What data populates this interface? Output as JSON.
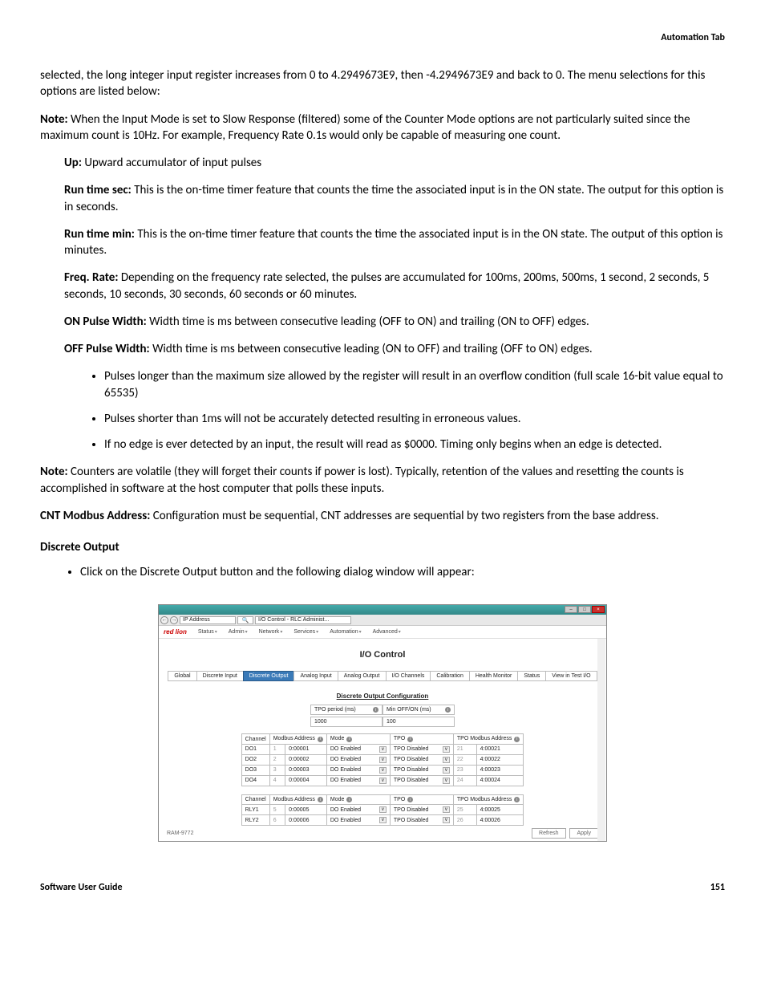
{
  "header": {
    "right": "Automation Tab"
  },
  "intro": "selected, the long integer input register increases from 0 to 4.2949673E9, then -4.2949673E9 and back to 0. The menu selections for this options are listed below:",
  "note1_label": "Note:",
  "note1": " When the Input Mode is set to Slow Response (filtered) some of the Counter Mode options are not particularly suited since the maximum count is 10Hz. For example, Frequency Rate 0.1s would only be capable of measuring one count.",
  "defs": {
    "up_l": "Up:",
    "up": " Upward accumulator of input pulses",
    "rts_l": "Run time sec:",
    "rts": " This is the on-time timer feature that counts the time the associated input is in the ON state. The output for this option is in seconds.",
    "rtm_l": "Run time min:",
    "rtm": " This is the on-time timer feature that counts the time the associated input is in the ON state. The output of this option is minutes.",
    "fr_l": "Freq. Rate:",
    "fr": " Depending on the frequency rate selected, the pulses are accumulated for 100ms, 200ms, 500ms, 1 second, 2 seconds, 5 seconds, 10 seconds, 30 seconds, 60 seconds or 60 minutes.",
    "on_l": "ON Pulse Width:",
    "on": " Width time is ms between consecutive leading (OFF to ON) and trailing (ON to OFF) edges.",
    "off_l": "OFF Pulse Width:",
    "off": " Width time is ms between consecutive leading (ON to OFF) and trailing (OFF to ON) edges."
  },
  "bullets": [
    "Pulses longer than the maximum size allowed by the register will result in an overflow condition (full scale 16-bit value equal to 65535)",
    "Pulses shorter than 1ms will not be accurately detected resulting in erroneous values.",
    "If no edge is ever detected by an input, the result will read as $0000. Timing only begins when an edge is detected."
  ],
  "note2_label": "Note:",
  "note2": " Counters are volatile (they will forget their counts if power is lost). Typically, retention of the values and resetting the counts is accomplished in software at the host computer that polls these inputs.",
  "cnt_l": "CNT Modbus Address:",
  "cnt": " Configuration must be sequential, CNT addresses are sequential by two registers from the base address.",
  "section": "Discrete Output",
  "section_bullet": "Click on the Discrete Output button and the following dialog window will appear:",
  "footer": {
    "left": "Software User Guide",
    "right": "151"
  },
  "shot": {
    "addr": "IP Address",
    "search_glyph": "🔍",
    "tab_title": "I/O Control - RLC Administ...",
    "menus": [
      "Status",
      "Admin",
      "Network",
      "Services",
      "Automation",
      "Advanced"
    ],
    "logo": "red lion",
    "title": "I/O Control",
    "tabs": [
      "Global",
      "Discrete Input",
      "Discrete Output",
      "Analog Input",
      "Analog Output",
      "I/O Channels",
      "Calibration",
      "Health Monitor",
      "Status",
      "View in Test I/O"
    ],
    "active_tab_index": 2,
    "subtitle": "Discrete Output Configuration",
    "tpo_period_label": "TPO period (ms)",
    "tpo_period_value": "1000",
    "min_off_label": "Min OFF/ON (ms)",
    "min_off_value": "100",
    "cols": [
      "Channel",
      "Modbus Address",
      "Mode",
      "TPO",
      "TPO Modbus Address",
      ""
    ],
    "rows1": [
      {
        "ch": "DO1",
        "idx": "1",
        "addr": "0:00001",
        "mode": "DO Enabled",
        "tpo": "TPO Disabled",
        "tidx": "21",
        "taddr": "4:00021"
      },
      {
        "ch": "DO2",
        "idx": "2",
        "addr": "0:00002",
        "mode": "DO Enabled",
        "tpo": "TPO Disabled",
        "tidx": "22",
        "taddr": "4:00022"
      },
      {
        "ch": "DO3",
        "idx": "3",
        "addr": "0:00003",
        "mode": "DO Enabled",
        "tpo": "TPO Disabled",
        "tidx": "23",
        "taddr": "4:00023"
      },
      {
        "ch": "DO4",
        "idx": "4",
        "addr": "0:00004",
        "mode": "DO Enabled",
        "tpo": "TPO Disabled",
        "tidx": "24",
        "taddr": "4:00024"
      }
    ],
    "rows2": [
      {
        "ch": "RLY1",
        "idx": "5",
        "addr": "0:00005",
        "mode": "DO Enabled",
        "tpo": "TPO Disabled",
        "tidx": "25",
        "taddr": "4:00025"
      },
      {
        "ch": "RLY2",
        "idx": "6",
        "addr": "0:00006",
        "mode": "DO Enabled",
        "tpo": "TPO Disabled",
        "tidx": "26",
        "taddr": "4:00026"
      }
    ],
    "device": "RAM-9772",
    "btn_refresh": "Refresh",
    "btn_apply": "Apply"
  }
}
